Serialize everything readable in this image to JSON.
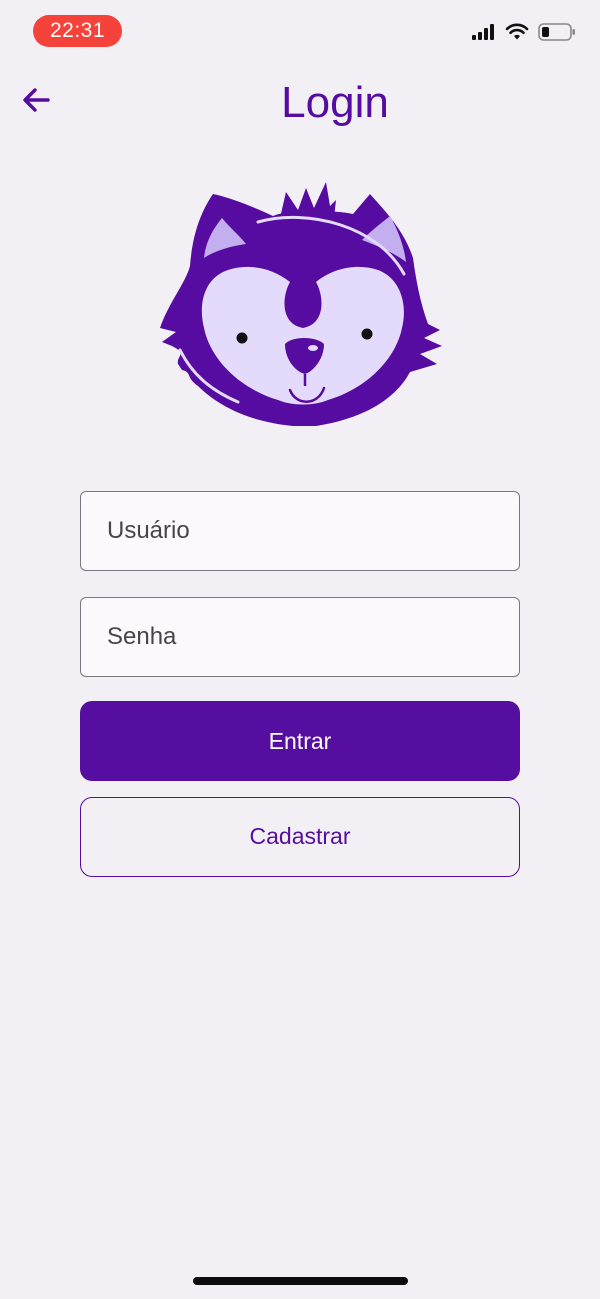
{
  "status_bar": {
    "time": "22:31",
    "time_pill_color": "#f5423a",
    "signal_icon": "cellular-signal-icon",
    "wifi_icon": "wifi-icon",
    "battery_icon": "battery-low-icon"
  },
  "header": {
    "title": "Login",
    "back_icon": "arrow-left-icon"
  },
  "logo": {
    "icon": "raccoon-face-logo"
  },
  "form": {
    "username_placeholder": "Usuário",
    "username_value": "",
    "password_placeholder": "Senha",
    "password_value": ""
  },
  "actions": {
    "login_label": "Entrar",
    "register_label": "Cadastrar"
  },
  "colors": {
    "accent": "#550ea0",
    "background": "#f2f0f4",
    "logo_light": "#e4dafb",
    "logo_ear": "#c3aeef"
  }
}
